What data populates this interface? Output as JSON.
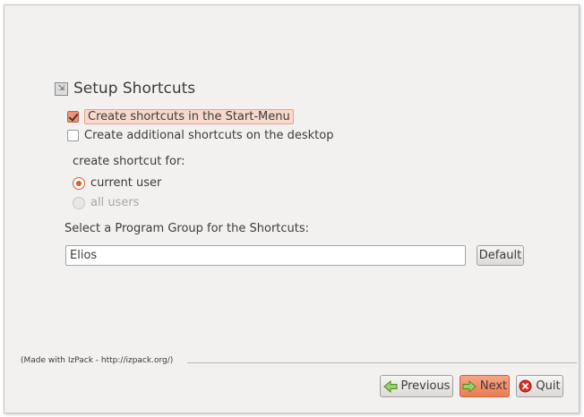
{
  "page": {
    "title": "Setup Shortcuts",
    "start_menu_checkbox": {
      "label": "Create shortcuts in the Start-Menu",
      "checked": true
    },
    "desktop_checkbox": {
      "label": "Create additional shortcuts on the desktop",
      "checked": false
    },
    "create_for_label": "create shortcut for:",
    "radio_current_user": {
      "label": "current user",
      "selected": true
    },
    "radio_all_users": {
      "label": "all users",
      "selected": false,
      "disabled": true
    },
    "program_group_label": "Select a Program Group for the Shortcuts:",
    "program_group_value": "Elios",
    "default_button": "Default"
  },
  "footer": {
    "made_with": "(Made with IzPack - http://izpack.org/)",
    "previous_label": "Previous",
    "next_label": "Next",
    "quit_label": "Quit"
  },
  "colors": {
    "accent": "#ec7c52",
    "window_bg": "#f2f1f0",
    "text": "#3c3c3c"
  },
  "icons": {
    "title": "shortcut-icon",
    "previous": "arrow-left-icon",
    "next": "arrow-right-icon",
    "quit": "close-icon"
  }
}
